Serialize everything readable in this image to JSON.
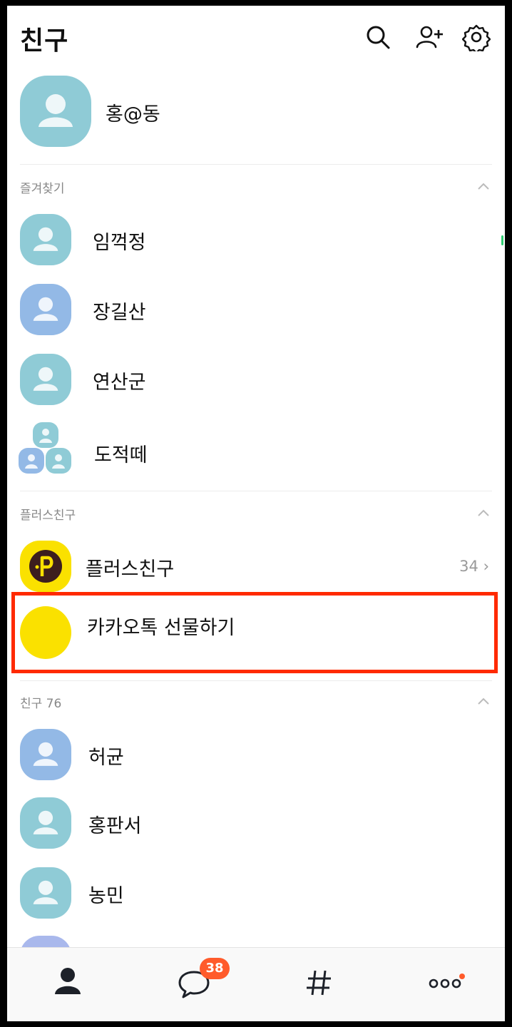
{
  "header": {
    "title": "친구",
    "icons": [
      "search-icon",
      "add-friend-icon",
      "settings-icon"
    ]
  },
  "profile": {
    "name": "홍@동"
  },
  "favorites": {
    "label": "즐겨찾기",
    "items": [
      {
        "name": "임꺽정",
        "avatar": "teal"
      },
      {
        "name": "장길산",
        "avatar": "blue"
      },
      {
        "name": "연산군",
        "avatar": "teal"
      },
      {
        "name": "도적떼",
        "avatar": "group"
      }
    ]
  },
  "plus_friends": {
    "label": "플러스친구",
    "items": [
      {
        "name": "플러스친구",
        "count": "34"
      },
      {
        "name": "카카오톡 선물하기"
      }
    ]
  },
  "friends": {
    "label": "친구 76",
    "items": [
      {
        "name": "허균",
        "avatar": "blue"
      },
      {
        "name": "홍판서",
        "avatar": "teal"
      },
      {
        "name": "농민",
        "avatar": "teal"
      }
    ]
  },
  "tabbar": {
    "tabs": [
      "friends-tab",
      "chats-tab",
      "hashtag-tab",
      "more-tab"
    ],
    "chat_badge": "38"
  },
  "colors": {
    "teal_avatar": "#8fcbd6",
    "blue_avatar": "#93b9e6",
    "kakao_yellow": "#fae100",
    "plus_dark": "#3c1e1e",
    "highlight": "#ff2a00",
    "badge": "#ff5b2b"
  }
}
